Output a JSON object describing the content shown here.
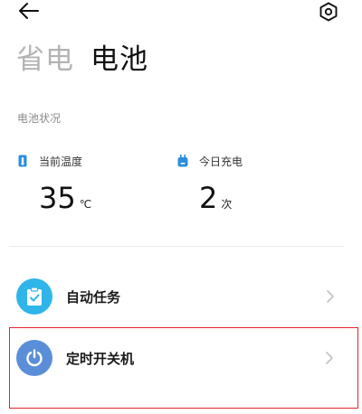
{
  "header": {
    "back_icon": "arrow-left-icon",
    "settings_icon": "settings-hexagon-icon"
  },
  "tabs": [
    {
      "label": "省电",
      "active": false
    },
    {
      "label": "电池",
      "active": true
    }
  ],
  "battery_status": {
    "section_title": "电池状况",
    "stats": [
      {
        "label": "当前温度",
        "value": "35",
        "unit": "℃",
        "icon": "thermometer-icon"
      },
      {
        "label": "今日充电",
        "value": "2",
        "unit": "次",
        "icon": "charger-icon"
      }
    ]
  },
  "list": [
    {
      "label": "自动任务",
      "icon": "clipboard-check-icon",
      "icon_color": "#2fb5ea"
    },
    {
      "label": "定时开关机",
      "icon": "power-icon",
      "icon_color": "#5b8ed8",
      "highlighted": true
    }
  ],
  "colors": {
    "accent_stat_icon": "#2b8de0",
    "highlight_border": "#e0242a"
  }
}
